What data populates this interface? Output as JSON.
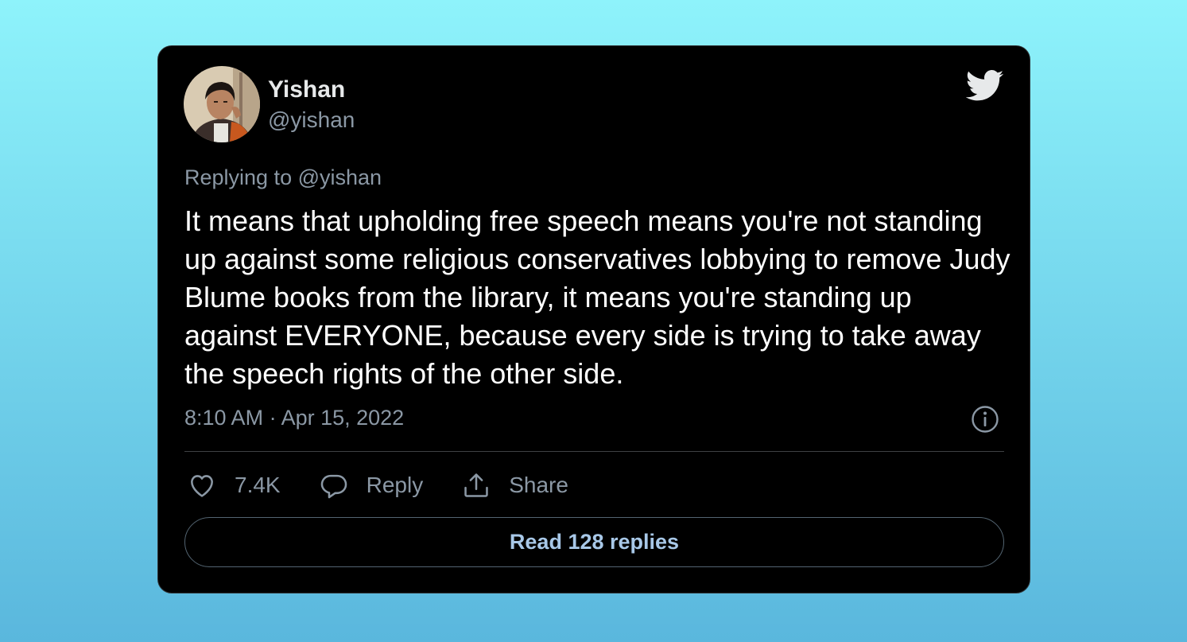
{
  "tweet": {
    "author": {
      "display_name": "Yishan",
      "handle": "@yishan"
    },
    "replying_to": "Replying to @yishan",
    "text": "It means that upholding free speech means you're not standing up against some religious conservatives lobbying to remove Judy Blume books from the library, it means you're standing up against EVERYONE, because every side is trying to take away the speech rights of the other side.",
    "timestamp": "8:10 AM · Apr 15, 2022"
  },
  "actions": {
    "like_count": "7.4K",
    "reply_label": "Reply",
    "share_label": "Share"
  },
  "read_replies_label": "Read 128 replies",
  "icons": {
    "brand": "twitter-bird-icon",
    "info": "info-icon",
    "like": "heart-icon",
    "reply": "speech-bubble-icon",
    "share": "share-icon"
  },
  "colors": {
    "card_background": "#000000",
    "twitter_blue": "#1d9bf0",
    "muted_text": "#8b98a5",
    "link_text": "#a8c8e8"
  }
}
